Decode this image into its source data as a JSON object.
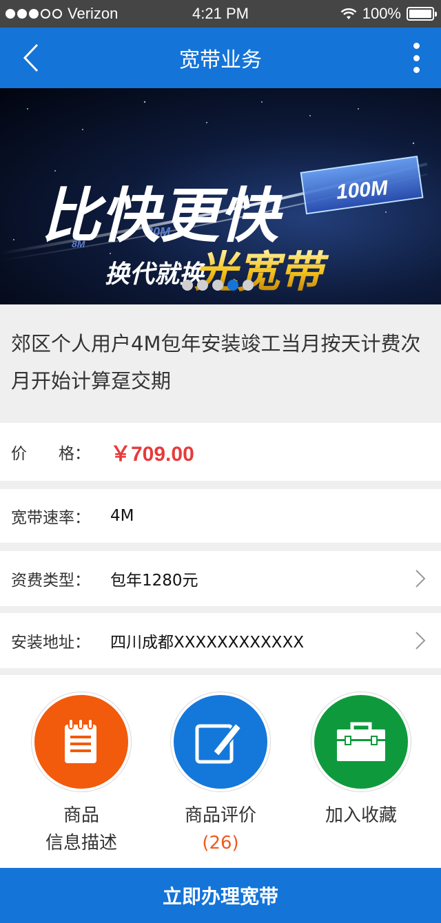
{
  "status_bar": {
    "carrier": "Verizon",
    "time": "4:21 PM",
    "battery": "100%",
    "signal_bars_filled": 3,
    "signal_bars_total": 5
  },
  "nav": {
    "title": "宽带业务",
    "back_icon": "chevron-left-icon",
    "more_icon": "more-vertical-icon"
  },
  "banner": {
    "headline": "比快更快",
    "subline_1": "换代就换",
    "subline_2": "光宽带",
    "speed_main": "100M",
    "speed_2": "20M",
    "speed_3": "8M",
    "dots": 5,
    "active_dot": 3
  },
  "product": {
    "title": "郊区个人用户4M包年安装竣工当月按天计费次月开始计算趸交期"
  },
  "info": {
    "price_label": "价　　格：",
    "price_value": "￥709.00",
    "speed_label": "宽带速率：",
    "speed_value": "4M",
    "fee_label": "资费类型：",
    "fee_value": "包年1280元",
    "address_label": "安装地址：",
    "address_value": "四川成都XXXXXXXXXXXX"
  },
  "actions": {
    "description_line1": "商品",
    "description_line2": "信息描述",
    "review_label": "商品评价",
    "review_count": "(26)",
    "favorite_label": "加入收藏"
  },
  "cta": {
    "label": "立即办理宽带"
  },
  "colors": {
    "primary": "#1474d8",
    "price": "#e63b3b",
    "description_icon_bg": "#f25a0c",
    "review_icon_bg": "#1478da",
    "favorite_icon_bg": "#0e9a3c",
    "review_count": "#ee5a1f"
  }
}
